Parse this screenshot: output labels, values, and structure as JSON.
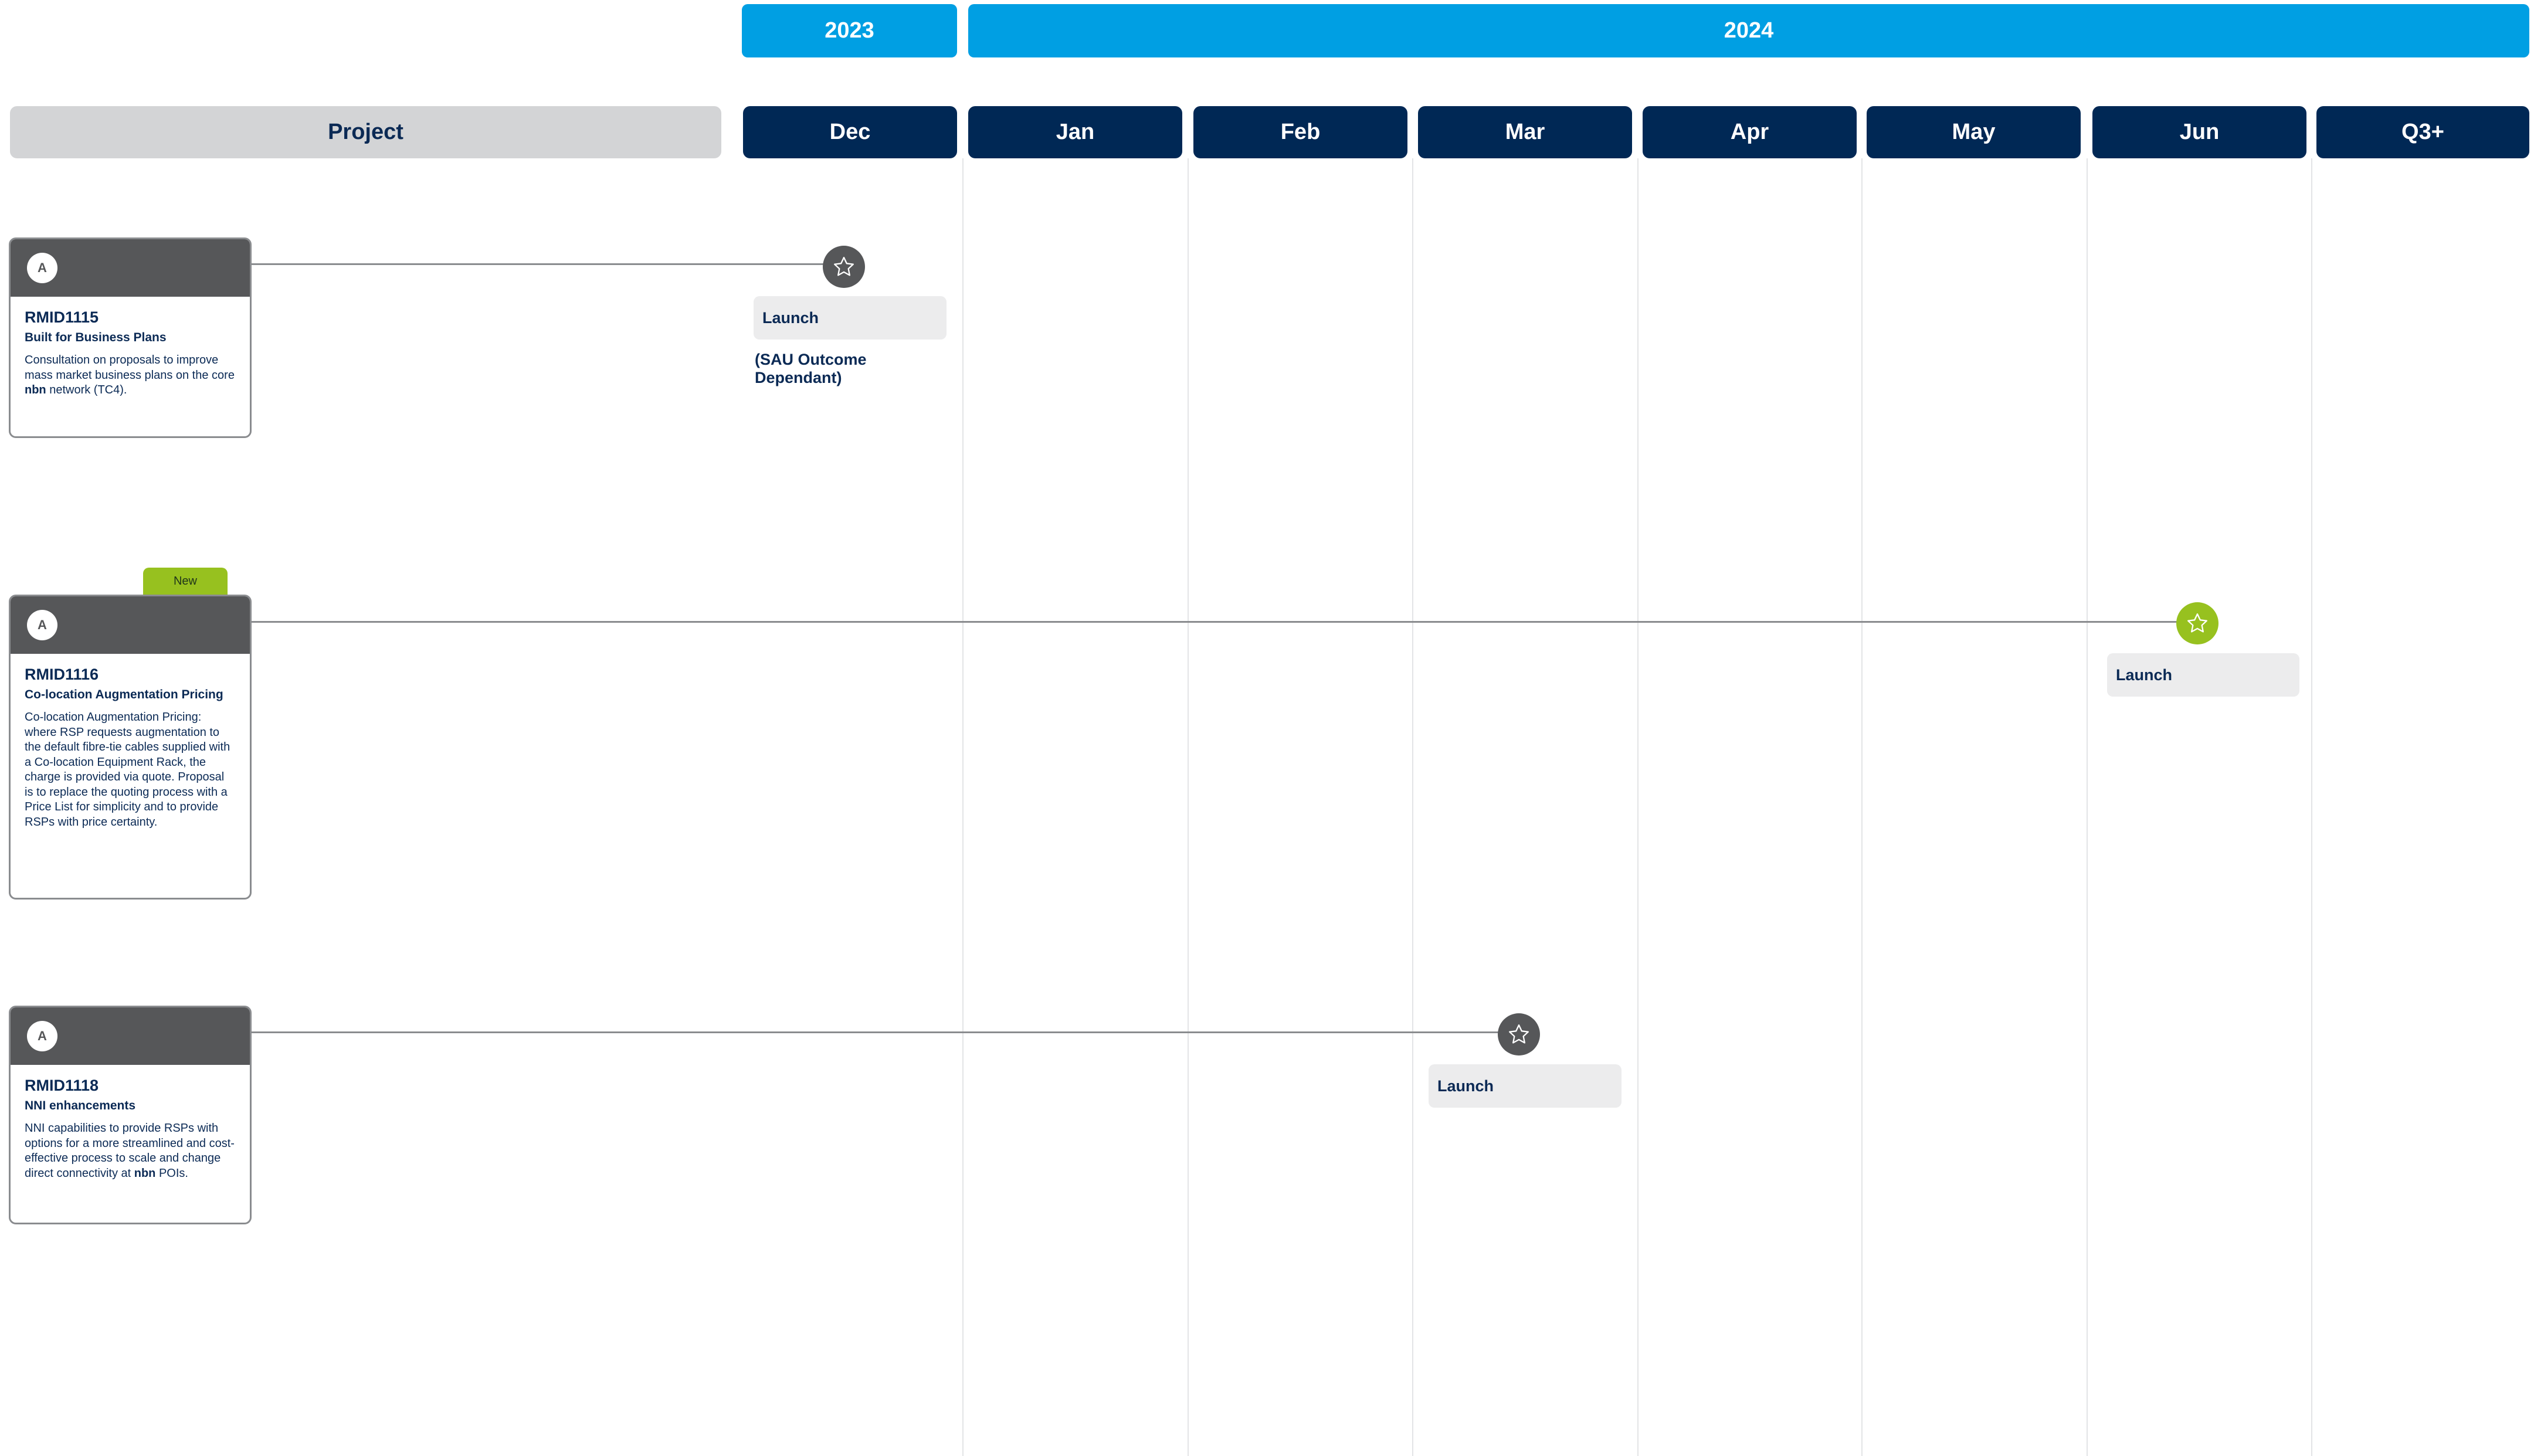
{
  "years": [
    {
      "label": "2023"
    },
    {
      "label": "2024"
    }
  ],
  "header": {
    "project_label": "Project"
  },
  "months": [
    {
      "label": "Dec"
    },
    {
      "label": "Jan"
    },
    {
      "label": "Feb"
    },
    {
      "label": "Mar"
    },
    {
      "label": "Apr"
    },
    {
      "label": "May"
    },
    {
      "label": "Jun"
    },
    {
      "label": "Q3+"
    }
  ],
  "projects": [
    {
      "avatar": "A",
      "id": "RMID1115",
      "subtitle": "Built for Business Plans",
      "desc_before": "Consultation on proposals to improve mass market business plans on the core ",
      "desc_bold": "nbn",
      "desc_after": " network (TC4).",
      "milestone_label": "Launch",
      "milestone_note": "(SAU Outcome Dependant)",
      "milestone_month": "Dec",
      "star_color": "#565759"
    },
    {
      "avatar": "A",
      "badge": "New",
      "id": "RMID1116",
      "subtitle": "Co-location Augmentation Pricing",
      "desc_before": "Co-location Augmentation Pricing: where RSP requests augmentation to the default fibre-tie cables supplied with a Co-location Equipment Rack, the charge is provided via quote. Proposal is to replace the quoting process with a Price List for simplicity and to provide RSPs with price certainty.",
      "desc_bold": "",
      "desc_after": "",
      "milestone_label": "Launch",
      "milestone_month": "Jun",
      "star_color": "#97c11f"
    },
    {
      "avatar": "A",
      "id": "RMID1118",
      "subtitle": "NNI enhancements",
      "desc_before": "NNI capabilities to provide RSPs with options for a more streamlined and cost-effective process to scale and change direct connectivity at ",
      "desc_bold": "nbn",
      "desc_after": " POIs.",
      "milestone_label": "Launch",
      "milestone_month": "Mar",
      "star_color": "#565759"
    }
  ],
  "icons": {
    "milestone": "star-icon",
    "avatar": "avatar"
  },
  "colors": {
    "year": "#009fe3",
    "month": "#002855",
    "card_header": "#565759",
    "new_badge": "#97c11f"
  }
}
